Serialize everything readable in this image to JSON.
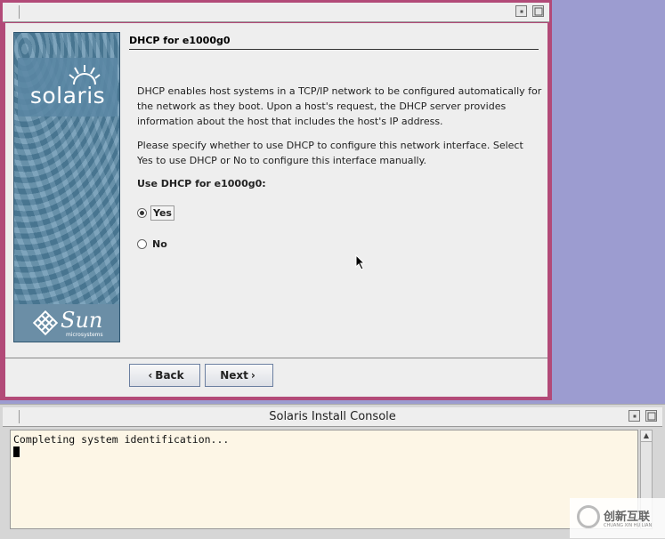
{
  "installer": {
    "sidebar": {
      "solaris_logo_text": "solaris",
      "sun_logo_text": "Sun",
      "sun_logo_sub": "microsystems"
    },
    "page_title": "DHCP for e1000g0",
    "paragraph1": "DHCP enables host systems in a TCP/IP network to be configured automatically for the network as they boot. Upon a host's request, the DHCP server provides information about the host that includes the host's IP address.",
    "paragraph2": "Please specify whether to use DHCP to configure this network interface. Select Yes to use DHCP or No to configure this interface manually.",
    "question": "Use DHCP for e1000g0:",
    "options": [
      {
        "label": "Yes",
        "selected": true
      },
      {
        "label": "No",
        "selected": false
      }
    ],
    "back_label": "Back",
    "next_label": "Next"
  },
  "console": {
    "title": "Solaris Install Console",
    "text": "Completing system identification..."
  },
  "watermark": {
    "text": "创新互联",
    "sub": "CHUANG XIN HU LIAN"
  },
  "colors": {
    "window_frame": "#b24a78",
    "desktop": "#9c9cd0",
    "console_bg": "#fdf6e6"
  }
}
